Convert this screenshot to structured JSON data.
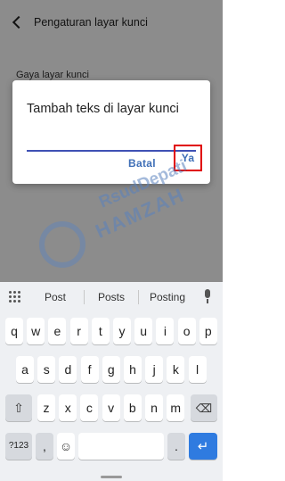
{
  "screen": {
    "title": "Pengaturan layar kunci",
    "setting_label": "Gaya layar kunci"
  },
  "dialog": {
    "title": "Tambah teks di layar kunci",
    "input_value": "",
    "cancel_label": "Batal",
    "ok_label": "Ya"
  },
  "watermark": {
    "line1": "RsudDepati",
    "line2": "HAMZAH"
  },
  "keyboard": {
    "suggestions": [
      "Post",
      "Posts",
      "Posting"
    ],
    "row1": [
      "q",
      "w",
      "e",
      "r",
      "t",
      "y",
      "u",
      "i",
      "o",
      "p"
    ],
    "row2": [
      "a",
      "s",
      "d",
      "f",
      "g",
      "h",
      "j",
      "k",
      "l"
    ],
    "row3": [
      "z",
      "x",
      "c",
      "v",
      "b",
      "n",
      "m"
    ],
    "symbols_label": "?123",
    "comma_label": ",",
    "period_label": "."
  },
  "colors": {
    "accent": "#3f51b5",
    "highlight": "#e00000",
    "enter_key": "#2f7be0"
  }
}
